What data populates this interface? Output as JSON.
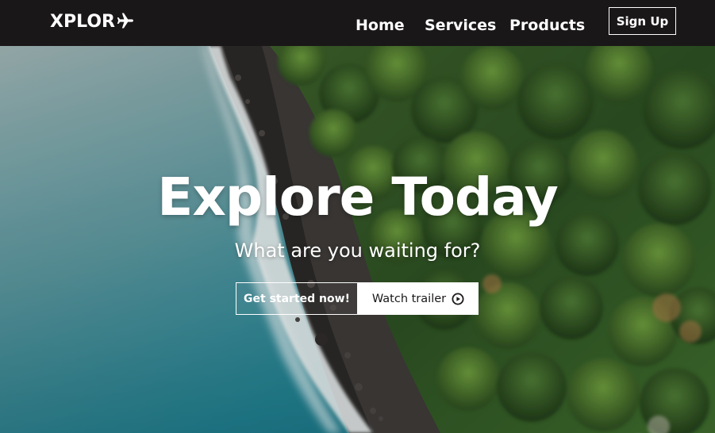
{
  "nav": {
    "logo_text": "XPLOR",
    "logo_icon": "airplane-icon",
    "links": [
      "Home",
      "Services",
      "Products"
    ],
    "signup_label": "Sign Up"
  },
  "hero": {
    "title": "Explore Today",
    "subtitle": "What are you waiting for?",
    "primary_button": "Get started now!",
    "secondary_button": "Watch trailer",
    "secondary_icon": "play-circle-icon"
  },
  "colors": {
    "navbar_bg": "#1a1718",
    "text_light": "#ffffff",
    "ocean": "#2a8e9e",
    "forest": "#2f5a22"
  }
}
